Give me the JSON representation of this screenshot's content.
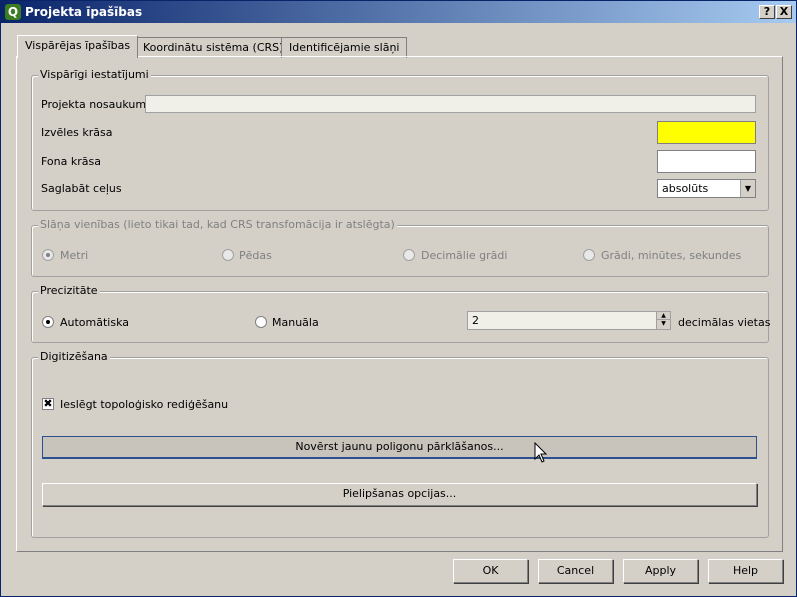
{
  "window": {
    "title": "Projekta īpašības",
    "help_btn": "?",
    "close_btn": "X",
    "app_icon": "Q"
  },
  "tabs": [
    {
      "label": "Vispārējas īpašības",
      "active": true
    },
    {
      "label": "Koordinātu sistēma (CRS)",
      "active": false
    },
    {
      "label": "Identificējamie slāņi",
      "active": false
    }
  ],
  "general": {
    "title": "Vispārīgi iestatījumi",
    "project_name_label": "Projekta nosaukums",
    "project_name_value": "",
    "selection_color_label": "Izvēles krāsa",
    "selection_color": "#ffff00",
    "background_color_label": "Fona krāsa",
    "background_color": "#ffffff",
    "save_path_label": "Saglabāt ceļus",
    "save_path_value": "absolūts"
  },
  "units": {
    "title": "Slāņa vienības (lieto tikai tad, kad CRS transfomācija ir atslēgta)",
    "options": [
      {
        "label": "Metri",
        "checked": true
      },
      {
        "label": "Pēdas",
        "checked": false
      },
      {
        "label": "Decimālie grādi",
        "checked": false
      },
      {
        "label": "Grādi, minūtes, sekundes",
        "checked": false
      }
    ]
  },
  "precision": {
    "title": "Precizitāte",
    "auto_label": "Automātiska",
    "auto_checked": true,
    "manual_label": "Manuāla",
    "manual_checked": false,
    "decimals_value": "2",
    "decimals_suffix": "decimālas vietas"
  },
  "digitizing": {
    "title": "Digitizēšana",
    "topology_label": "Ieslēgt topoloģisko rediģēšanu",
    "topology_checked": true,
    "avoid_overlap_button": "Novērst jaunu poligonu pārklāšanos...",
    "snapping_button": "Pielipšanas opcijas..."
  },
  "buttons": {
    "ok": "OK",
    "cancel": "Cancel",
    "apply": "Apply",
    "help": "Help"
  }
}
